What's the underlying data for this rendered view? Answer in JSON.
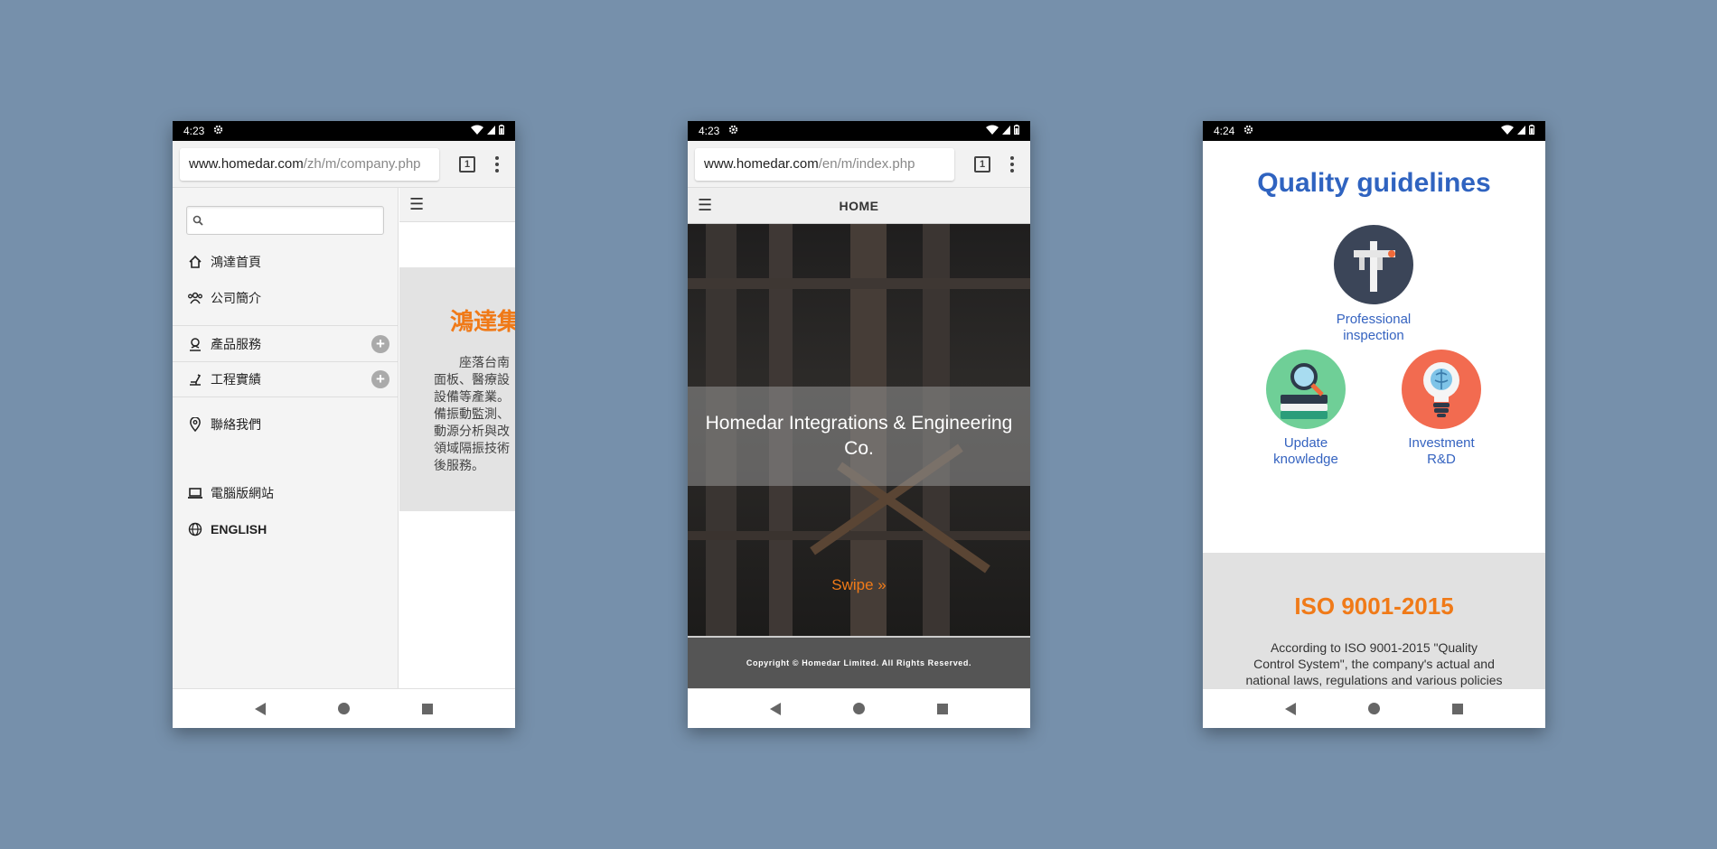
{
  "phones": [
    {
      "time": "4:23",
      "url_host": "www.homedar.com",
      "url_path": "/zh/m/company.php",
      "tab_count": "1",
      "menu": [
        {
          "label": "鴻達首頁",
          "icon": "home-icon"
        },
        {
          "label": "公司簡介",
          "icon": "people-icon"
        },
        {
          "label": "產品服務",
          "icon": "product-icon"
        },
        {
          "label": "工程實績",
          "icon": "engineering-icon"
        },
        {
          "label": "聯絡我們",
          "icon": "location-pin-icon"
        },
        {
          "label": "電腦版網站",
          "icon": "laptop-icon"
        },
        {
          "label": "ENGLISH",
          "icon": "globe-icon"
        }
      ],
      "content_title": "鴻達集",
      "content_text": "　　座落台南\n面板、醫療設\n設備等產業。\n備振動監測、\n動源分析與改\n領域隔振技術\n後服務。"
    },
    {
      "time": "4:23",
      "url_host": "www.homedar.com",
      "url_path": "/en/m/index.php",
      "tab_count": "1",
      "header_title": "HOME",
      "hero_title": "Homedar Integrations & Engineering Co.",
      "swipe_label": "Swipe »",
      "footer": "Copyright © Homedar Limited. All Rights Reserved."
    },
    {
      "time": "4:24",
      "title": "Quality guidelines",
      "items": [
        {
          "label": "Professional\ninspection",
          "icon": "caliper-icon"
        },
        {
          "label": "Update\nknowledge",
          "icon": "books-magnifier-icon"
        },
        {
          "label": "Investment\nR&D",
          "icon": "lightbulb-brain-icon"
        }
      ],
      "iso_title": "ISO 9001-2015",
      "iso_text": "According to ISO 9001-2015 \"Quality\nControl System\", the company's actual and\nnational laws, regulations and various policies"
    }
  ],
  "colors": {
    "background": "#7690ab",
    "accent_orange": "#f07a18",
    "accent_blue": "#2f63c0"
  }
}
